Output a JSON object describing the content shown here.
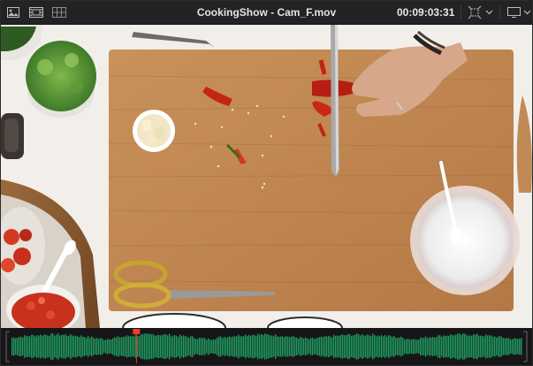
{
  "header": {
    "title": "CookingShow - Cam_F.mov",
    "timecode": "00:09:03:31"
  },
  "icons": {
    "left": [
      "image-view-icon",
      "film-strip-icon",
      "grid-view-icon"
    ],
    "right": [
      "transform-icon",
      "dropdown-chevron-icon",
      "monitor-view-icon",
      "dropdown-chevron-icon"
    ]
  },
  "scrubber": {
    "playhead_position": 0.245
  },
  "colors": {
    "waveform": "#1f9a5f",
    "playhead": "#e8402c",
    "header_bg": "#232326"
  }
}
